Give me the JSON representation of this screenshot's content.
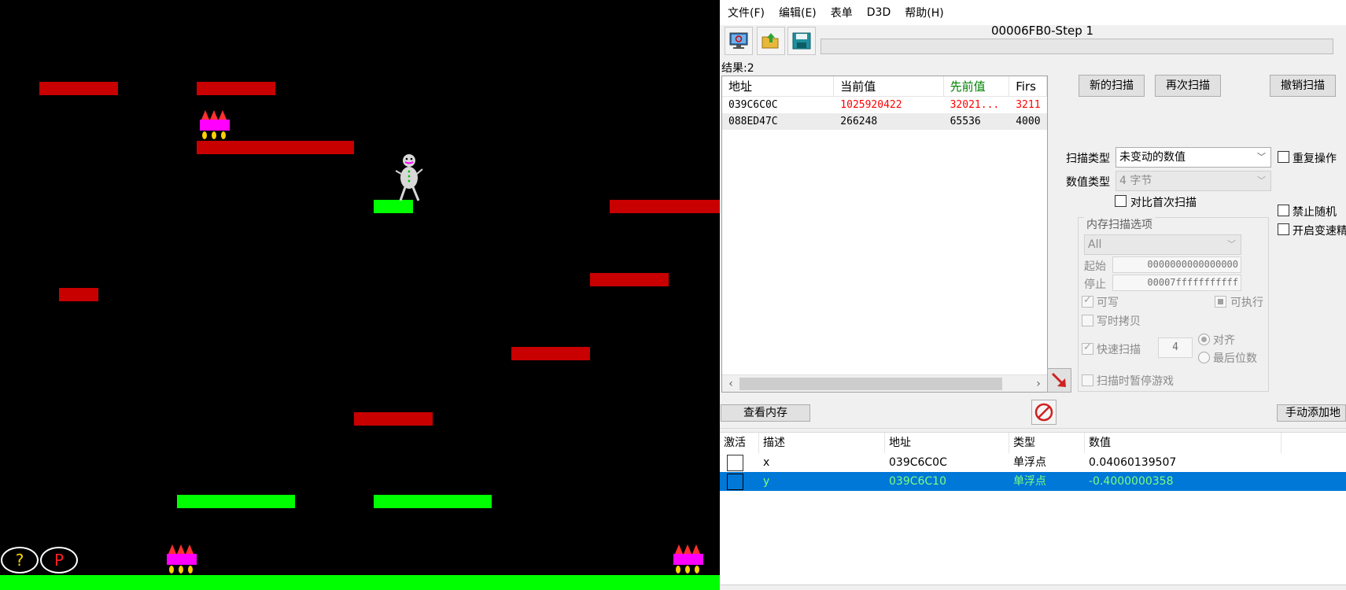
{
  "game": {
    "help_label": "?",
    "pause_label": "P"
  },
  "ce": {
    "menu": [
      "文件(F)",
      "编辑(E)",
      "表单",
      "D3D",
      "帮助(H)"
    ],
    "process_title": "00006FB0-Step 1",
    "results_label": "结果:2",
    "results": {
      "columns": [
        "地址",
        "当前值",
        "先前值",
        "Firs"
      ],
      "rows": [
        {
          "address": "039C6C0C",
          "current": "1025920422",
          "previous": "32021...",
          "first": "3211"
        },
        {
          "address": "088ED47C",
          "current": "266248",
          "previous": "65536",
          "first": "4000"
        }
      ]
    },
    "buttons": {
      "new_scan": "新的扫描",
      "next_scan": "再次扫描",
      "undo_scan": "撤销扫描",
      "view_memory": "查看内存",
      "add_address_manually": "手动添加地"
    },
    "scan": {
      "scan_type_label": "扫描类型",
      "scan_type_value": "未变动的数值",
      "value_type_label": "数值类型",
      "value_type_value": "4 字节",
      "compare_first_label": "对比首次扫描",
      "repeat_op_label": "重复操作",
      "disable_random_label": "禁止随机",
      "speedhack_label": "开启变速精",
      "mem_options_title": "内存扫描选项",
      "region_value": "All",
      "start_label": "起始",
      "start_value": "0000000000000000",
      "stop_label": "停止",
      "stop_value": "00007fffffffffff",
      "writable_label": "可写",
      "executable_label": "可执行",
      "copy_on_write_label": "写时拷贝",
      "fast_scan_label": "快速扫描",
      "fast_scan_value": "4",
      "align_label": "对齐",
      "last_digits_label": "最后位数",
      "pause_game_label": "扫描时暂停游戏"
    },
    "address_table": {
      "columns": [
        "激活",
        "描述",
        "地址",
        "类型",
        "数值"
      ],
      "rows": [
        {
          "description": "x",
          "address": "039C6C0C",
          "type": "单浮点",
          "value": "0.04060139507"
        },
        {
          "description": "y",
          "address": "039C6C10",
          "type": "单浮点",
          "value": "-0.4000000358"
        }
      ]
    },
    "colors": {
      "previous_header": "#008000",
      "changed_value": "#ff0000",
      "selection": "#0078d7"
    }
  }
}
